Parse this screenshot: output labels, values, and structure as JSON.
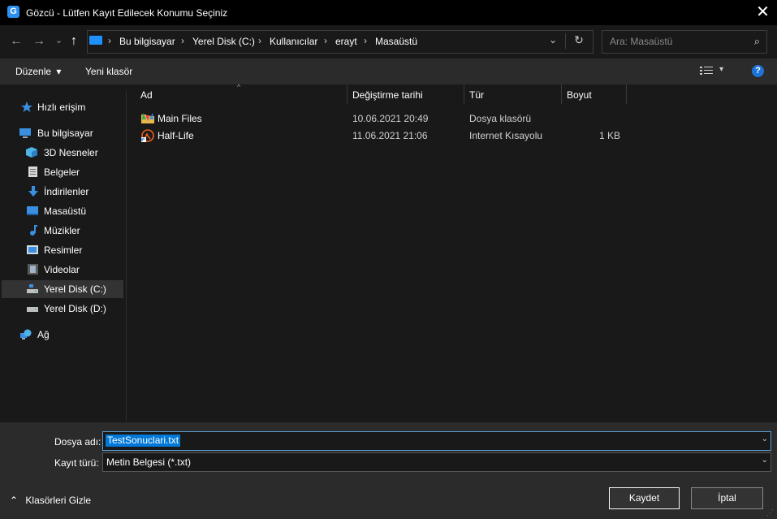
{
  "window": {
    "title": "Gözcü - Lütfen Kayıt Edilecek Konumu Seçiniz",
    "app_icon_letter": "G",
    "close_glyph": "✕"
  },
  "nav": {
    "back": "←",
    "forward": "→",
    "recent": "⌄",
    "up": "↑",
    "breadcrumb": [
      "Bu bilgisayar",
      "Yerel Disk (C:)",
      "Kullanıcılar",
      "erayt",
      "Masaüstü"
    ],
    "separator": "›",
    "dropdown": "⌄",
    "refresh": "↻",
    "search_placeholder": "Ara: Masaüstü",
    "search_icon": "⌕"
  },
  "toolbar": {
    "organize": "Düzenle",
    "organize_arrow": "▾",
    "new_folder": "Yeni klasör",
    "view_dropdown": "▾",
    "help": "?"
  },
  "sidebar": {
    "items": [
      {
        "label": "Hızlı erişim",
        "icon": "star-icon"
      },
      {
        "label": "Bu bilgisayar",
        "icon": "computer-icon"
      },
      {
        "label": "3D Nesneler",
        "icon": "cube-icon"
      },
      {
        "label": "Belgeler",
        "icon": "document-icon"
      },
      {
        "label": "İndirilenler",
        "icon": "download-icon"
      },
      {
        "label": "Masaüstü",
        "icon": "desktop-icon"
      },
      {
        "label": "Müzikler",
        "icon": "music-icon"
      },
      {
        "label": "Resimler",
        "icon": "picture-icon"
      },
      {
        "label": "Videolar",
        "icon": "video-icon"
      },
      {
        "label": "Yerel Disk (C:)",
        "icon": "drive-icon",
        "selected": true
      },
      {
        "label": "Yerel Disk (D:)",
        "icon": "drive-icon"
      },
      {
        "label": "Ağ",
        "icon": "network-icon"
      }
    ]
  },
  "columns": {
    "name": "Ad",
    "modified": "Değiştirme tarihi",
    "type": "Tür",
    "size": "Boyut",
    "sort_glyph": "^"
  },
  "files": [
    {
      "name": "Main Files",
      "modified": "10.06.2021 20:49",
      "type": "Dosya klasörü",
      "size": ""
    },
    {
      "name": "Half-Life",
      "modified": "11.06.2021 21:06",
      "type": "Internet Kısayolu",
      "size": "1 KB"
    }
  ],
  "bottom": {
    "filename_label": "Dosya adı:",
    "filename_value": "TestSonuclari.txt",
    "filetype_label": "Kayıt türü:",
    "filetype_value": "Metin Belgesi (*.txt)",
    "dropdown_arrow": "⌄",
    "hide_folders": "Klasörleri Gizle",
    "hide_folders_arrow": "⌃",
    "save": "Kaydet",
    "cancel": "İptal",
    "grip": "⋰"
  },
  "colors": {
    "accent": "#0078d7",
    "background": "#191919",
    "bar": "#2b2b2b",
    "titlebar": "#000000"
  }
}
